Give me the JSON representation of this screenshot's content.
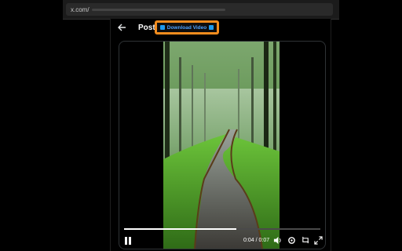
{
  "browser": {
    "url_text": "x.com/"
  },
  "header": {
    "title": "Post",
    "download_label": "Download Video"
  },
  "video": {
    "current_time": "0:04",
    "duration": "0:07",
    "time_separator": "/",
    "progress": 0.57
  },
  "colors": {
    "accent_orange": "#f28c1e",
    "accent_blue": "#1d9bf0"
  },
  "icons": [
    "back-arrow-icon",
    "pause-icon",
    "volume-icon",
    "settings-icon",
    "picture-in-picture-icon",
    "fullscreen-icon"
  ]
}
